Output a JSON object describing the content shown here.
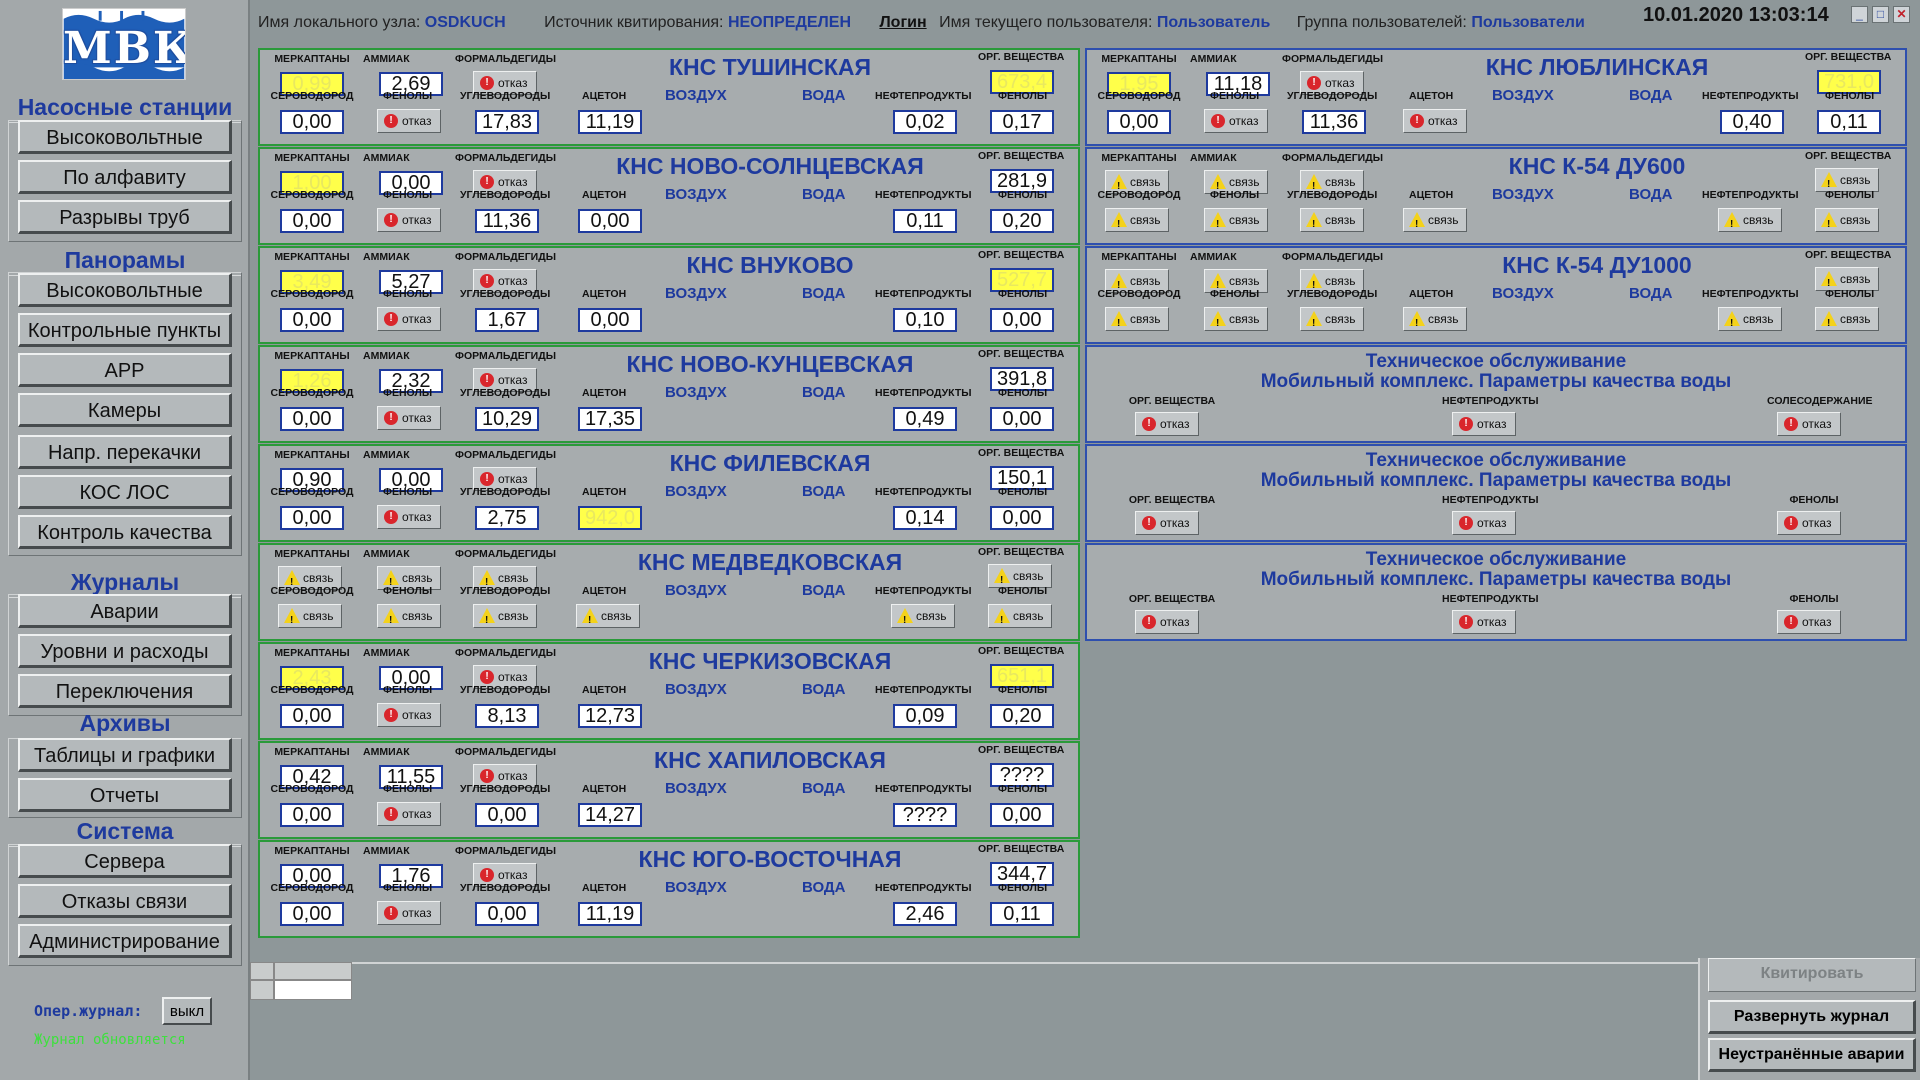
{
  "header": {
    "node_label": "Имя локального узла:",
    "node_value": "OSDKUCH",
    "ack_source_label": "Источник квитирования:",
    "ack_source_value": "НЕОПРЕДЕЛЕН",
    "login_link": "Логин",
    "user_label": "Имя текущего пользователя:",
    "user_value": "Пользователь",
    "group_label": "Группа пользователей:",
    "group_value": "Пользователи",
    "datetime": "10.01.2020  13:03:14"
  },
  "logo": {
    "text": "МВК"
  },
  "sidebar": {
    "pumps_head": "Насосные  станции",
    "pumps": [
      "Высоковольтные",
      "По алфавиту",
      "Разрывы труб"
    ],
    "panoramas_head": "Панорамы",
    "panoramas": [
      "Высоковольтные",
      "Контрольные пункты",
      "АРР",
      "Камеры",
      "Напр. перекачки",
      "КОС ЛОС",
      "Контроль качества"
    ],
    "journals_head": "Журналы",
    "journals": [
      "Аварии",
      "Уровни и расходы",
      "Переключения"
    ],
    "archives_head": "Архивы",
    "archives": [
      "Таблицы и графики",
      "Отчеты"
    ],
    "system_head": "Система",
    "system": [
      "Сервера",
      "Отказы связи",
      "Администрирование"
    ],
    "oper_label": "Опер.журнал:",
    "oper_btn": "выкл",
    "journal_status": "Журнал обновляется"
  },
  "labels": {
    "merk": "МЕРКАПТАНЫ",
    "amm": "АММИАК",
    "form": "ФОРМАЛЬДЕГИДЫ",
    "org": "ОРГ. ВЕЩЕСТВА",
    "serovod": "СЕРОВОДОРОД",
    "fenol": "ФЕНОЛЫ",
    "uglevod": "УГЛЕВОДОРОДЫ",
    "aceton": "АЦЕТОН",
    "neft": "НЕФТЕПРОДУКТЫ",
    "air": "ВОЗДУХ",
    "water": "ВОДА",
    "soles": "СОЛЕСОДЕРЖАНИЕ"
  },
  "status_text": {
    "err": "отказ",
    "conn": "связь"
  },
  "stations": [
    {
      "title": "КНС ТУШИНСКАЯ",
      "merk": "0,99",
      "amm": "2,69",
      "form": "err",
      "org": "673,4",
      "serovod": "0,00",
      "fenol_air": "err",
      "uglevod": "17,83",
      "aceton": "11,19",
      "neft": "0,02",
      "fenol": "0,17",
      "warn": [
        "merk",
        "org"
      ]
    },
    {
      "title": "КНС НОВО-СОЛНЦЕВСКАЯ",
      "merk": "1,00",
      "amm": "0,00",
      "form": "err",
      "org": "281,9",
      "serovod": "0,00",
      "fenol_air": "err",
      "uglevod": "11,36",
      "aceton": "0,00",
      "neft": "0,11",
      "fenol": "0,20",
      "warn": [
        "merk"
      ]
    },
    {
      "title": "КНС ВНУКОВО",
      "merk": "3,49",
      "amm": "5,27",
      "form": "err",
      "org": "527,7",
      "serovod": "0,00",
      "fenol_air": "err",
      "uglevod": "1,67",
      "aceton": "0,00",
      "neft": "0,10",
      "fenol": "0,00",
      "warn": [
        "merk",
        "org"
      ]
    },
    {
      "title": "КНС НОВО-КУНЦЕВСКАЯ",
      "merk": "1,26",
      "amm": "2,32",
      "form": "err",
      "org": "391,8",
      "serovod": "0,00",
      "fenol_air": "err",
      "uglevod": "10,29",
      "aceton": "17,35",
      "neft": "0,49",
      "fenol": "0,00",
      "warn": [
        "merk"
      ]
    },
    {
      "title": "КНС ФИЛЕВСКАЯ",
      "merk": "0,90",
      "amm": "0,00",
      "form": "err",
      "org": "150,1",
      "serovod": "0,00",
      "fenol_air": "err",
      "uglevod": "2,75",
      "aceton": "942,0",
      "neft": "0,14",
      "fenol": "0,00",
      "warn": [
        "aceton"
      ]
    },
    {
      "title": "КНС МЕДВЕДКОВСКАЯ",
      "merk": "conn",
      "amm": "conn",
      "form": "conn",
      "org": "conn",
      "serovod": "conn",
      "fenol_air": "conn",
      "uglevod": "conn",
      "aceton": "conn",
      "neft": "conn",
      "fenol": "conn",
      "warn": []
    },
    {
      "title": "КНС ЧЕРКИЗОВСКАЯ",
      "merk": "2,43",
      "amm": "0,00",
      "form": "err",
      "org": "651,1",
      "serovod": "0,00",
      "fenol_air": "err",
      "uglevod": "8,13",
      "aceton": "12,73",
      "neft": "0,09",
      "fenol": "0,20",
      "warn": [
        "merk",
        "org"
      ]
    },
    {
      "title": "КНС ХАПИЛОВСКАЯ",
      "merk": "0,42",
      "amm": "11,55",
      "form": "err",
      "org": "????",
      "serovod": "0,00",
      "fenol_air": "err",
      "uglevod": "0,00",
      "aceton": "14,27",
      "neft": "????",
      "fenol": "0,00",
      "warn": []
    },
    {
      "title": "КНС ЮГО-ВОСТОЧНАЯ",
      "merk": "0,00",
      "amm": "1,76",
      "form": "err",
      "org": "344,7",
      "serovod": "0,00",
      "fenol_air": "err",
      "uglevod": "0,00",
      "aceton": "11,19",
      "neft": "2,46",
      "fenol": "0,11",
      "warn": []
    }
  ],
  "stations_right": [
    {
      "title": "КНС ЛЮБЛИНСКАЯ",
      "merk": "1,95",
      "amm": "11,18",
      "form": "err",
      "org": "731,0",
      "serovod": "0,00",
      "fenol_air": "err",
      "uglevod": "11,36",
      "aceton": "err",
      "neft": "0,40",
      "fenol": "0,11",
      "warn": [
        "merk",
        "org"
      ]
    },
    {
      "title": "КНС К-54 ДУ600",
      "merk": "conn",
      "amm": "conn",
      "form": "conn",
      "org": "conn",
      "serovod": "conn",
      "fenol_air": "conn",
      "uglevod": "conn",
      "aceton": "conn",
      "neft": "conn",
      "fenol": "conn",
      "warn": []
    },
    {
      "title": "КНС К-54 ДУ1000",
      "merk": "conn",
      "amm": "conn",
      "form": "conn",
      "org": "conn",
      "serovod": "conn",
      "fenol_air": "conn",
      "uglevod": "conn",
      "aceton": "conn",
      "neft": "conn",
      "fenol": "conn",
      "warn": []
    }
  ],
  "tech": [
    {
      "line1": "Техническое обслуживание",
      "line2": "Мобильный комплекс. Параметры качества воды",
      "l1": "ОРГ. ВЕЩЕСТВА",
      "l2": "НЕФТЕПРОДУКТЫ",
      "l3": "СОЛЕСОДЕРЖАНИЕ"
    },
    {
      "line1": "Техническое обслуживание",
      "line2": "Мобильный комплекс. Параметры качества воды",
      "l1": "ОРГ. ВЕЩЕСТВА",
      "l2": "НЕФТЕПРОДУКТЫ",
      "l3": "ФЕНОЛЫ"
    },
    {
      "line1": "Техническое обслуживание",
      "line2": "Мобильный комплекс. Параметры качества воды",
      "l1": "ОРГ. ВЕЩЕСТВА",
      "l2": "НЕФТЕПРОДУКТЫ",
      "l3": "ФЕНОЛЫ"
    }
  ],
  "footer": {
    "ack_btn": "Квитировать",
    "expand_btn": "Развернуть журнал",
    "alarms_btn": "Неустранённые аварии"
  },
  "colors": {
    "accent": "#1e3a9e",
    "panel_green": "#2a9a3a",
    "panel_blue": "#2e4fae",
    "warn_yellow": "#ffff3c",
    "error_red": "#d9262c"
  },
  "icons": [
    "error-icon",
    "warning-icon",
    "minimize-icon",
    "maximize-icon",
    "close-icon"
  ]
}
